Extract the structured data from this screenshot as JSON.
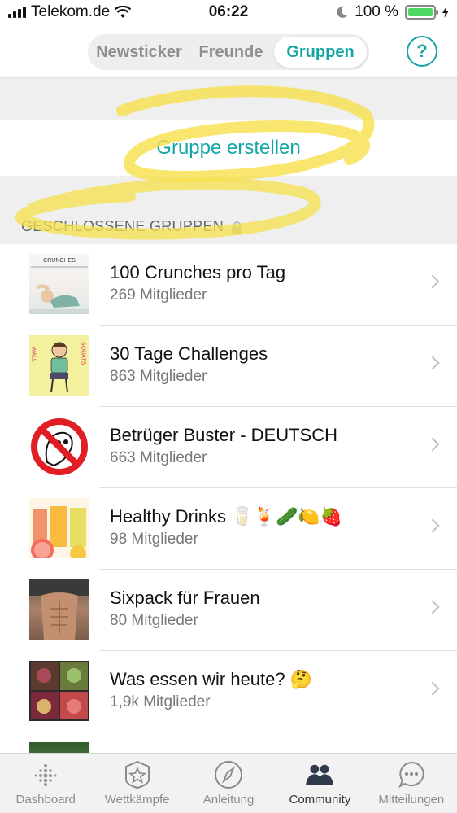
{
  "status_bar": {
    "carrier": "Telekom.de",
    "time": "06:22",
    "battery": "100 %"
  },
  "header": {
    "tabs": [
      {
        "label": "Newsticker",
        "active": false
      },
      {
        "label": "Freunde",
        "active": false
      },
      {
        "label": "Gruppen",
        "active": true
      }
    ],
    "help_label": "?"
  },
  "create_group_label": "Gruppe erstellen",
  "section": {
    "title": "GESCHLOSSENE GRUPPEN",
    "icon": "lock-icon"
  },
  "groups": [
    {
      "name": "100 Crunches pro Tag",
      "members": "269 Mitglieder",
      "thumb_caption": "CRUNCHES"
    },
    {
      "name": "30 Tage Challenges",
      "members": "863 Mitglieder",
      "thumb_left": "WALL",
      "thumb_right": "SQUATS"
    },
    {
      "name": "Betrüger Buster - DEUTSCH",
      "members": "663 Mitglieder"
    },
    {
      "name": "Healthy Drinks 🥛🍹🥒🍋🍓",
      "members": "98 Mitglieder"
    },
    {
      "name": "Sixpack für Frauen",
      "members": "80 Mitglieder"
    },
    {
      "name": "Was essen wir heute? 🤔",
      "members": "1,9k Mitglieder"
    }
  ],
  "tabbar": [
    {
      "label": "Dashboard",
      "icon": "dashboard-dots-icon",
      "active": false
    },
    {
      "label": "Wettkämpfe",
      "icon": "star-badge-icon",
      "active": false
    },
    {
      "label": "Anleitung",
      "icon": "compass-icon",
      "active": false
    },
    {
      "label": "Community",
      "icon": "people-icon",
      "active": true
    },
    {
      "label": "Mitteilungen",
      "icon": "chat-bubble-icon",
      "active": false
    }
  ],
  "colors": {
    "accent": "#14a6a6",
    "highlight": "#f6e04a",
    "battery": "#4cd964"
  }
}
